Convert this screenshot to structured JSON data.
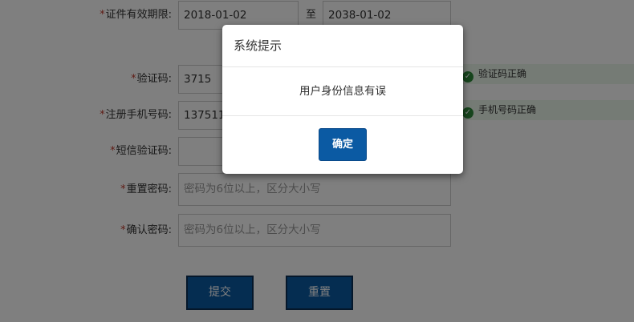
{
  "form": {
    "cert_validity": {
      "required_mark": "*",
      "label": "证件有效期限:",
      "start_value": "2018-01-02",
      "separator": "至",
      "end_value": "2038-01-02"
    },
    "captcha": {
      "required_mark": "*",
      "label": "验证码:",
      "value": "3715",
      "ok_message": "验证码正确"
    },
    "phone": {
      "required_mark": "*",
      "label": "注册手机号码:",
      "value": "137511",
      "ok_message": "手机号码正确"
    },
    "sms_code": {
      "required_mark": "*",
      "label": "短信验证码:",
      "value": ""
    },
    "reset_password": {
      "required_mark": "*",
      "label": "重置密码:",
      "placeholder": "密码为6位以上，区分大小写"
    },
    "confirm_password": {
      "required_mark": "*",
      "label": "确认密码:",
      "placeholder": "密码为6位以上，区分大小写"
    },
    "buttons": {
      "submit": "提交",
      "reset": "重置"
    }
  },
  "modal": {
    "title": "系统提示",
    "message": "用户身份信息有误",
    "ok_label": "确定"
  },
  "icons": {
    "ok_icon": "check-circle-icon"
  },
  "colors": {
    "primary_button": "#0b5aa3",
    "required_mark": "#c0392b",
    "success": "#2e8b3b",
    "success_bg": "#eaf6ea"
  }
}
